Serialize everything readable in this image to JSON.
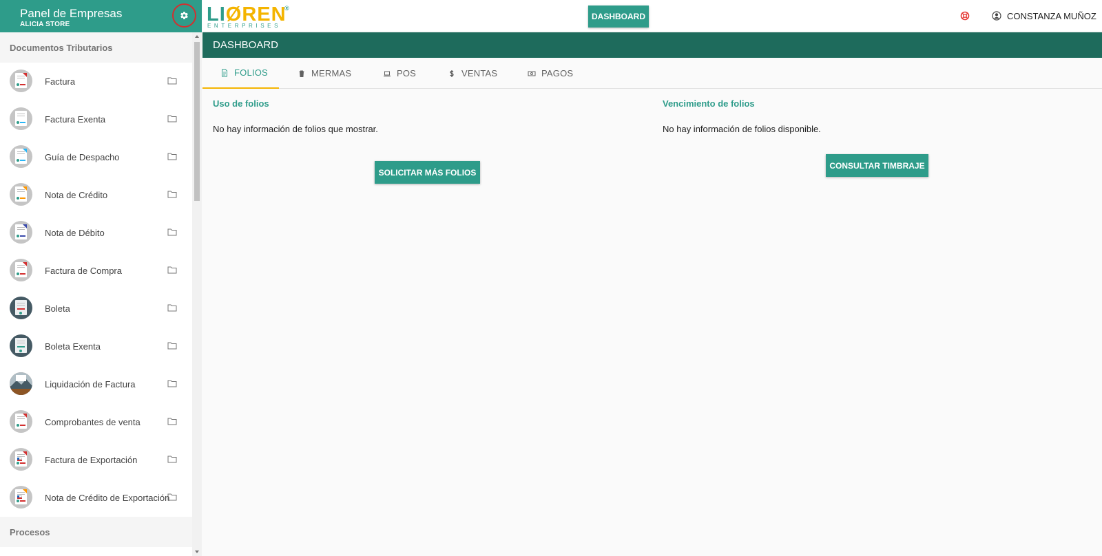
{
  "sidebar": {
    "title": "Panel de Empresas",
    "subtitle": "ALICIA STORE",
    "sections": [
      {
        "title": "Documentos Tributarios",
        "items": [
          {
            "label": "Factura",
            "accent": "#d32f2f"
          },
          {
            "label": "Factura Exenta",
            "accent": "#29b6f6"
          },
          {
            "label": "Guía de Despacho",
            "accent": "#29b6f6"
          },
          {
            "label": "Nota de Crédito",
            "accent": "#ff9800"
          },
          {
            "label": "Nota de Débito",
            "accent": "#3949ab"
          },
          {
            "label": "Factura de Compra",
            "accent": "#d32f2f"
          },
          {
            "label": "Boleta",
            "accent": "#d32f2f"
          },
          {
            "label": "Boleta Exenta",
            "accent": "#2e9c8a"
          },
          {
            "label": "Liquidación de Factura",
            "accent": "#8d6e63"
          },
          {
            "label": "Comprobantes de venta",
            "accent": "#d32f2f"
          },
          {
            "label": "Factura de Exportación",
            "accent": "#d32f2f"
          },
          {
            "label": "Nota de Crédito de Exportación",
            "accent": "#ff9800"
          }
        ]
      },
      {
        "title": "Procesos"
      }
    ]
  },
  "topbar": {
    "logo_text_1": "LI",
    "logo_text_2": "Ø",
    "logo_text_3": "REN",
    "logo_reg": "®",
    "logo_sub": "ENTERPRISES",
    "dashboard_button": "DASHBOARD",
    "user_name": "CONSTANZA MUÑOZ"
  },
  "page": {
    "title": "DASHBOARD",
    "tabs": [
      {
        "label": "FOLIOS",
        "icon": "document-icon",
        "active": true
      },
      {
        "label": "MERMAS",
        "icon": "trash-icon",
        "active": false
      },
      {
        "label": "POS",
        "icon": "laptop-icon",
        "active": false
      },
      {
        "label": "VENTAS",
        "icon": "dollar-icon",
        "active": false
      },
      {
        "label": "PAGOS",
        "icon": "money-icon",
        "active": false
      }
    ]
  },
  "folios": {
    "usage_title": "Uso de folios",
    "usage_text": "No hay información de folios que mostrar.",
    "usage_button": "SOLICITAR MÁS FOLIOS",
    "expiry_title": "Vencimiento de folios",
    "expiry_text": "No hay información de folios disponible.",
    "expiry_button": "CONSULTAR TIMBRAJE"
  },
  "colors": {
    "primary": "#2e9c8a",
    "primary_dark": "#1e6b5c",
    "accent": "#f4b400",
    "alert": "#d32f2f"
  }
}
